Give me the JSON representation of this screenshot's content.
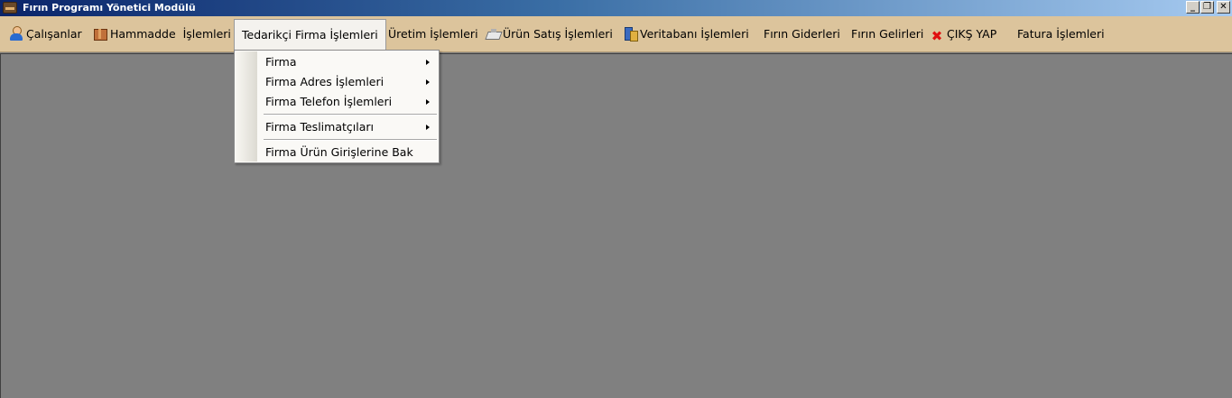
{
  "window": {
    "title": "Fırın Programı Yönetici Modülü",
    "min_glyph": "_",
    "restore_glyph": "❐",
    "close_glyph": "✕"
  },
  "menu": {
    "items": [
      {
        "label": "Çalışanlar",
        "icon": "user-icon"
      },
      {
        "label": "Hammadde  İşlemleri",
        "icon": "box-icon"
      },
      {
        "label": "Tedarikçi Firma İşlemleri",
        "open": true
      },
      {
        "label": "Üretim İşlemleri"
      },
      {
        "label": "Ürün Satış İşlemleri",
        "icon": "cash-register-icon"
      },
      {
        "label": "Veritabanı İşlemleri",
        "icon": "database-icon"
      },
      {
        "label": "Fırın Giderleri"
      },
      {
        "label": "Fırın Gelirleri"
      },
      {
        "label": "ÇIKŞ YAP",
        "icon": "red-x-icon",
        "icon_glyph": "✖"
      },
      {
        "label": "Fatura İşlemleri"
      }
    ]
  },
  "dropdown": {
    "items": [
      {
        "label": "Firma",
        "has_submenu": true
      },
      {
        "label": "Firma Adres İşlemleri",
        "has_submenu": true
      },
      {
        "label": "Firma Telefon İşlemleri",
        "has_submenu": true
      },
      {
        "label": "Firma Teslimatçıları",
        "has_submenu": true
      },
      {
        "label": "Firma Ürün Girişlerine Bak",
        "has_submenu": false
      }
    ]
  },
  "colors": {
    "menubar": "#dcc49c",
    "client_area": "#808080",
    "title_gradient_start": "#0a246a",
    "exit_icon": "#e01010"
  }
}
